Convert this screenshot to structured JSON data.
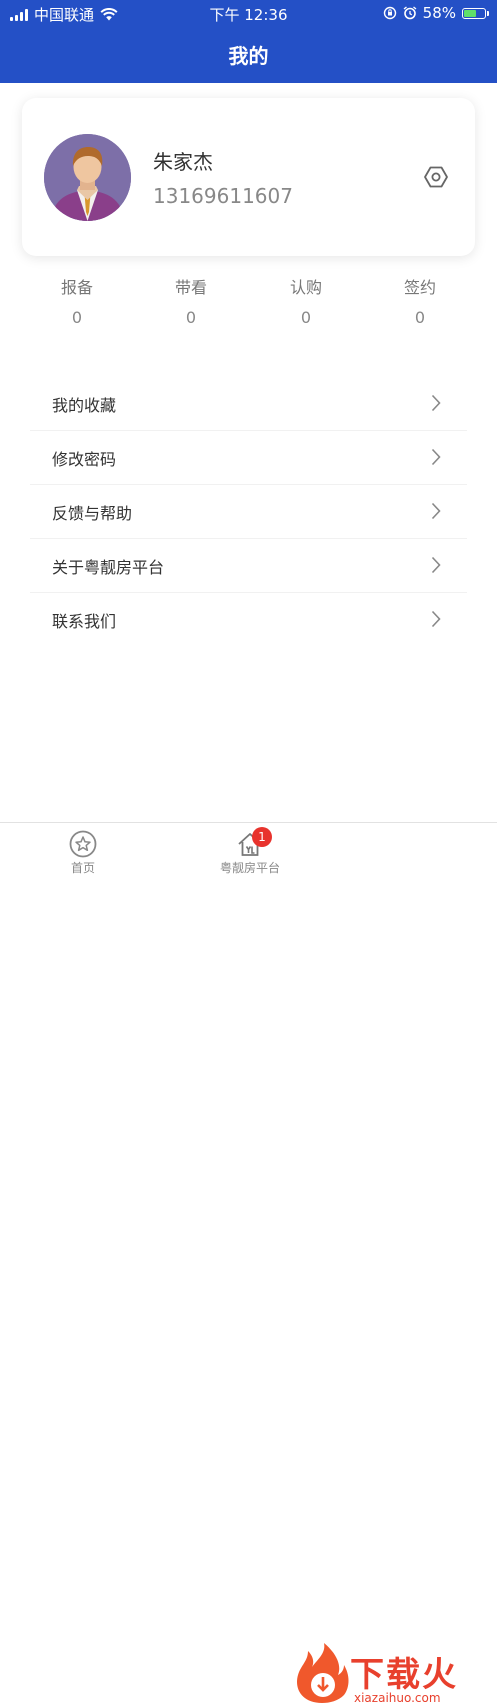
{
  "status_bar": {
    "carrier": "中国联通",
    "time": "下午 12:36",
    "battery": "58%",
    "battery_level": 0.58
  },
  "header": {
    "title": "我的"
  },
  "profile": {
    "name": "朱家杰",
    "phone": "13169611607"
  },
  "stats": [
    {
      "label": "报备",
      "value": "0"
    },
    {
      "label": "带看",
      "value": "0"
    },
    {
      "label": "认购",
      "value": "0"
    },
    {
      "label": "签约",
      "value": "0"
    }
  ],
  "menu": [
    {
      "label": "我的收藏"
    },
    {
      "label": "修改密码"
    },
    {
      "label": "反馈与帮助"
    },
    {
      "label": "关于粤靓房平台"
    },
    {
      "label": "联系我们"
    }
  ],
  "tabbar": {
    "home_label": "首页",
    "platform_label": "粤靓房平台",
    "platform_badge": "1"
  },
  "watermark": {
    "text": "下载火",
    "domain": "xiazaihuo.com"
  },
  "colors": {
    "header": "#2450c6",
    "badge": "#e8332d",
    "watermark": "#e8402d"
  }
}
